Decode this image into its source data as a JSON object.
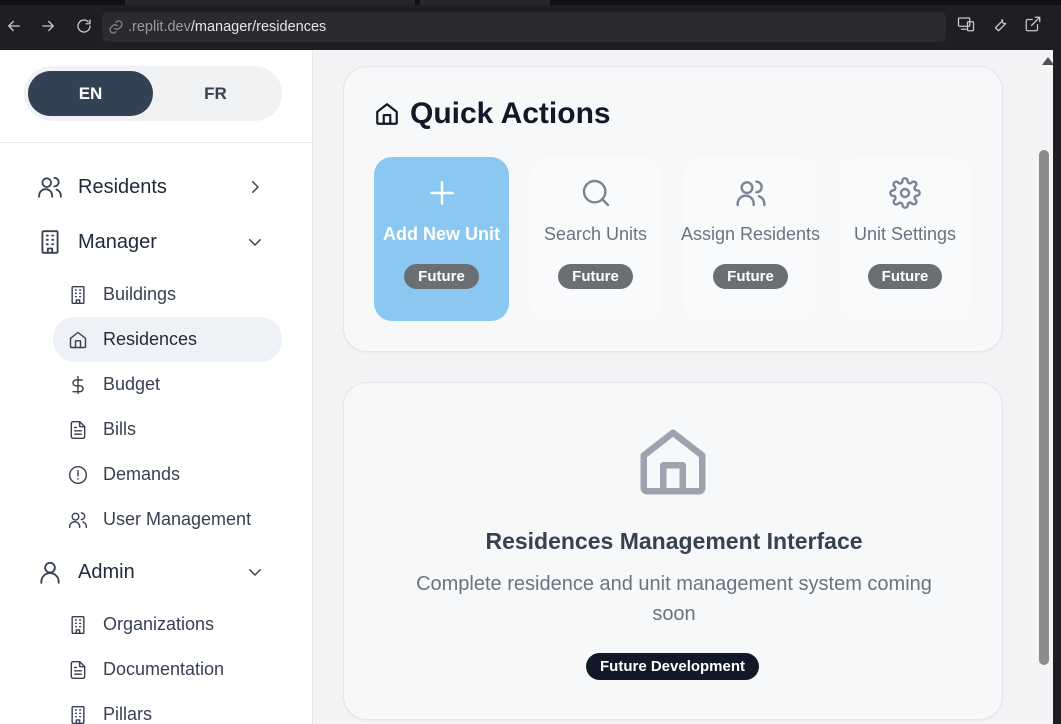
{
  "browser": {
    "url_host": ".replit.dev",
    "url_path": "/manager/residences"
  },
  "language": {
    "options": [
      "EN",
      "FR"
    ],
    "active": "EN"
  },
  "sidebar": {
    "groups": [
      {
        "label": "Residents",
        "icon": "users-icon",
        "expanded": false
      },
      {
        "label": "Manager",
        "icon": "building-icon",
        "expanded": true
      },
      {
        "label": "Admin",
        "icon": "user-icon",
        "expanded": true
      }
    ],
    "manager_items": [
      {
        "label": "Buildings",
        "icon": "building-icon"
      },
      {
        "label": "Residences",
        "icon": "home-icon",
        "active": true
      },
      {
        "label": "Budget",
        "icon": "dollar-icon"
      },
      {
        "label": "Bills",
        "icon": "file-icon"
      },
      {
        "label": "Demands",
        "icon": "alert-circle-icon"
      },
      {
        "label": "User Management",
        "icon": "users-icon"
      }
    ],
    "admin_items": [
      {
        "label": "Organizations",
        "icon": "building-icon"
      },
      {
        "label": "Documentation",
        "icon": "file-icon"
      },
      {
        "label": "Pillars",
        "icon": "building-icon"
      }
    ]
  },
  "quick_actions": {
    "title": "Quick Actions",
    "actions": [
      {
        "label": "Add New Unit",
        "badge": "Future",
        "icon": "plus-icon"
      },
      {
        "label": "Search Units",
        "badge": "Future",
        "icon": "search-icon"
      },
      {
        "label": "Assign Residents",
        "badge": "Future",
        "icon": "users-icon"
      },
      {
        "label": "Unit Settings",
        "badge": "Future",
        "icon": "gear-icon"
      }
    ]
  },
  "info": {
    "title": "Residences Management Interface",
    "description": "Complete residence and unit management system coming soon",
    "badge": "Future Development"
  },
  "colors": {
    "primary_action": "#8ac8f2",
    "active_lang": "#334155",
    "badge_dark": "#111827"
  }
}
